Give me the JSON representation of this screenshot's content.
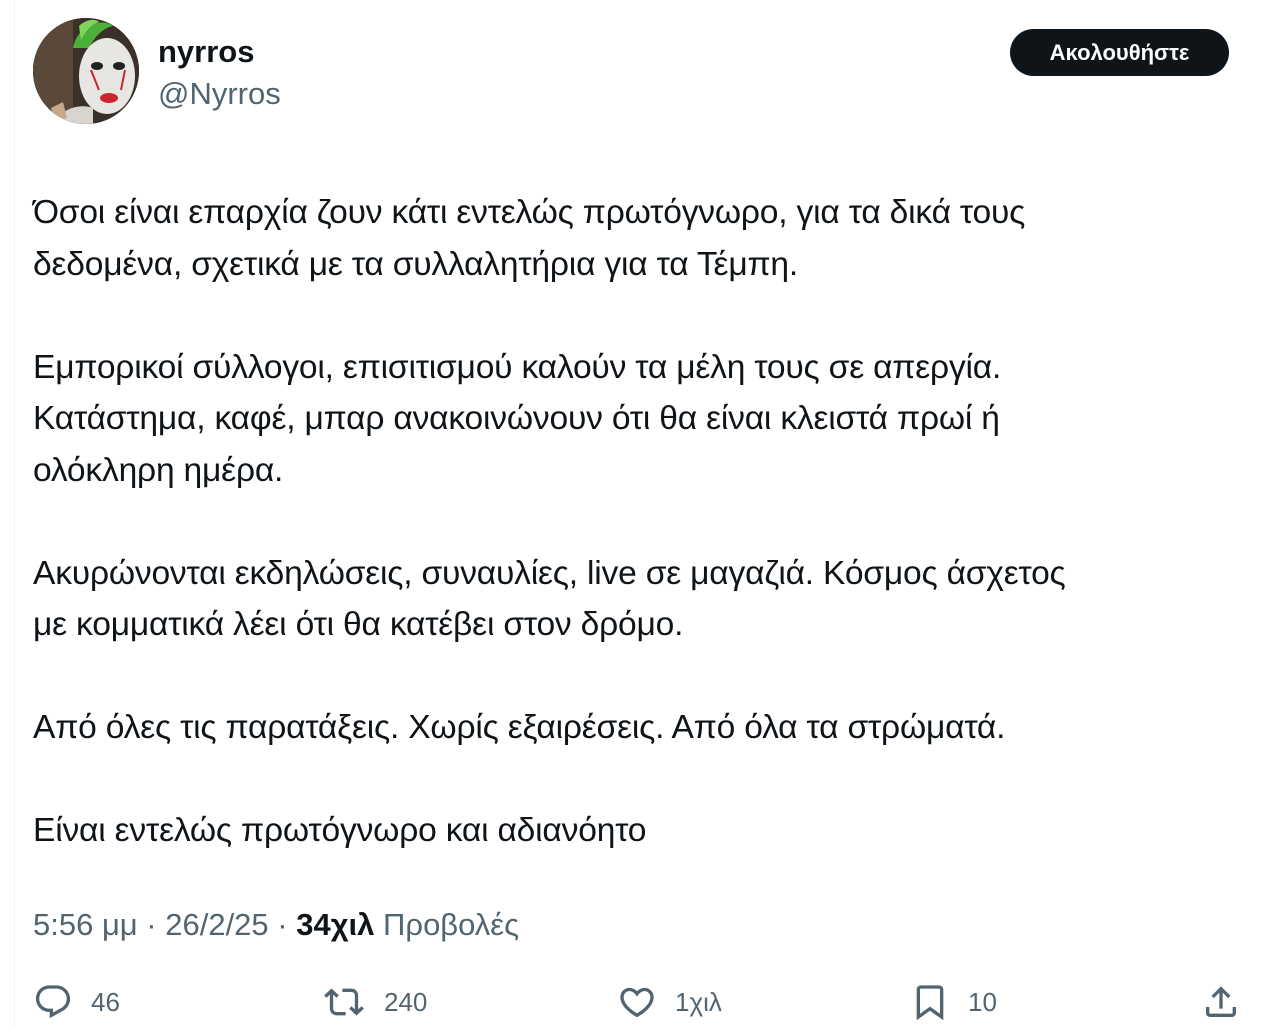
{
  "author": {
    "display_name": "nyrros",
    "handle": "@Nyrros",
    "follow_label": "Ακολουθήστε"
  },
  "tweet": {
    "lines": [
      "Όσοι είναι επαρχία ζουν κάτι εντελώς πρωτόγνωρο, για τα δικά τους",
      "δεδομένα, σχετικά με τα συλλαλητήρια για τα Τέμπη.",
      "",
      "Εμπορικοί σύλλογοι, επισιτισμού καλούν τα μέλη τους σε απεργία.",
      "Κατάστημα, καφέ, μπαρ ανακοινώνουν ότι θα είναι κλειστά πρωί ή",
      "ολόκληρη ημέρα.",
      "",
      "Ακυρώνονται εκδηλώσεις, συναυλίες, live σε μαγαζιά. Κόσμος άσχετος",
      "με κομματικά λέει ότι θα κατέβει στον δρόμο.",
      "",
      "Από όλες τις παρατάξεις. Χωρίς εξαιρέσεις. Από όλα τα στρώματά.",
      "",
      "Είναι εντελώς πρωτόγνωρο και αδιανόητο"
    ]
  },
  "meta": {
    "time": "5:56 μμ",
    "separator": " · ",
    "date": "26/2/25",
    "views_count": "34χιλ",
    "views_label": "Προβολές"
  },
  "actions": {
    "reply": {
      "icon": "reply-icon",
      "count": "46"
    },
    "repost": {
      "icon": "repost-icon",
      "count": "240"
    },
    "like": {
      "icon": "heart-icon",
      "count": "1χιλ"
    },
    "bookmark": {
      "icon": "bookmark-icon",
      "count": "10"
    },
    "share": {
      "icon": "share-icon"
    }
  },
  "colors": {
    "text": "#0f1419",
    "secondary": "#536471",
    "button_bg": "#0f1419",
    "button_text": "#ffffff"
  }
}
